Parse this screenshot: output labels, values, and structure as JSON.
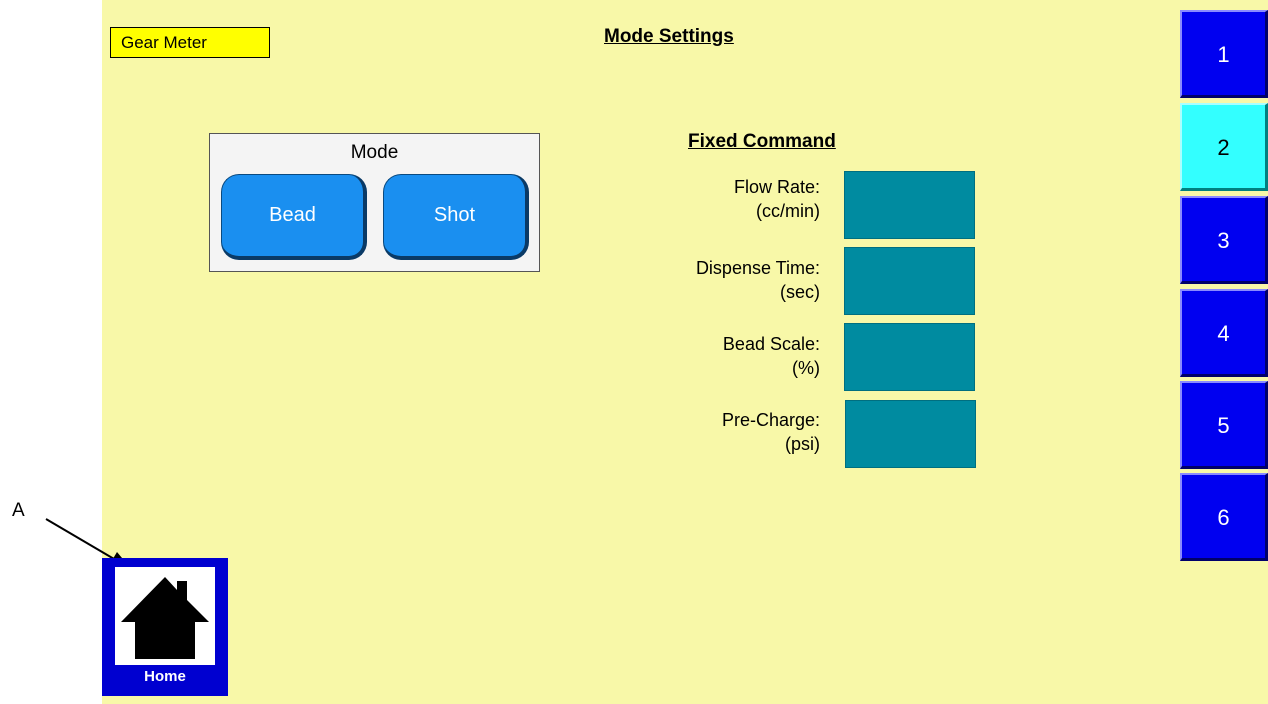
{
  "annotation": {
    "label": "A"
  },
  "header": {
    "device_label": "Gear Meter",
    "title": "Mode Settings"
  },
  "mode": {
    "title": "Mode",
    "buttons": [
      {
        "label": "Bead"
      },
      {
        "label": "Shot"
      }
    ]
  },
  "fixed_command": {
    "title": "Fixed Command",
    "fields": [
      {
        "label": "Flow Rate:",
        "unit": "(cc/min)",
        "value": ""
      },
      {
        "label": "Dispense Time:",
        "unit": "(sec)",
        "value": ""
      },
      {
        "label": "Bead Scale:",
        "unit": "(%)",
        "value": ""
      },
      {
        "label": "Pre-Charge:",
        "unit": "(psi)",
        "value": ""
      }
    ]
  },
  "side_nav": {
    "items": [
      {
        "label": "1",
        "active": false
      },
      {
        "label": "2",
        "active": true
      },
      {
        "label": "3",
        "active": false
      },
      {
        "label": "4",
        "active": false
      },
      {
        "label": "5",
        "active": false
      },
      {
        "label": "6",
        "active": false
      }
    ]
  },
  "home": {
    "label": "Home",
    "icon": "house-icon"
  },
  "colors": {
    "background": "#f8f8a8",
    "device_label_bg": "#ffff00",
    "mode_button": "#1a8ff0",
    "field_box": "#008ba0",
    "side_button": "#0000f0",
    "side_button_active": "#33ffff",
    "home_button": "#0000d0"
  }
}
